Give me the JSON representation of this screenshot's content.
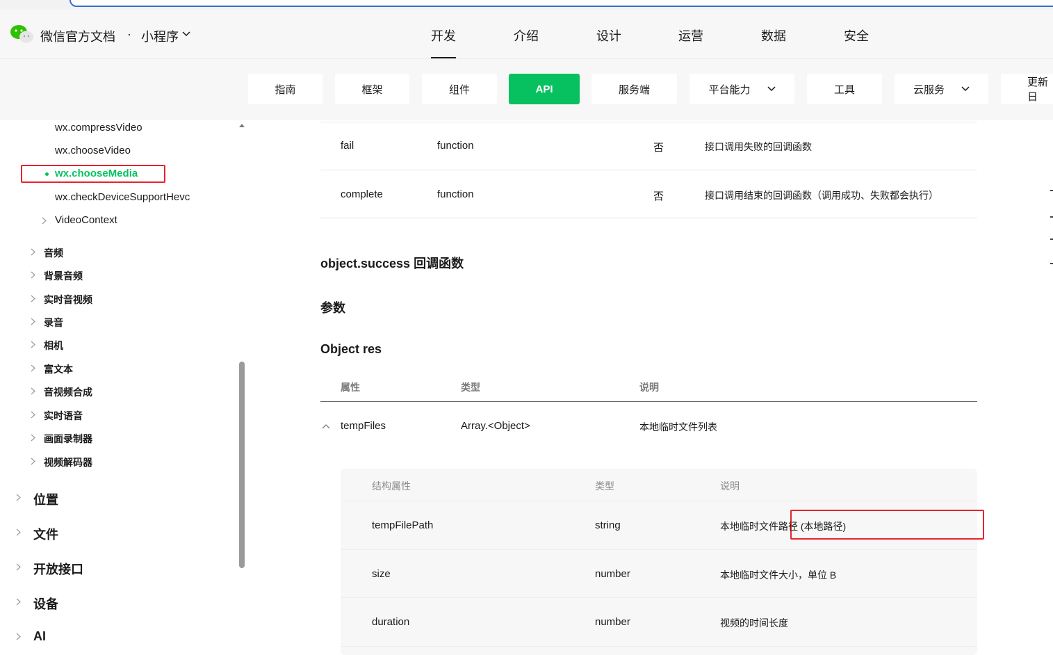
{
  "header": {
    "brand": "微信官方文档",
    "brand_sub": "小程序",
    "nav": [
      "开发",
      "介绍",
      "设计",
      "运营",
      "数据",
      "安全"
    ]
  },
  "tabs": [
    "指南",
    "框架",
    "组件",
    "API",
    "服务端",
    "平台能力",
    "工具",
    "云服务",
    "更新日"
  ],
  "sidebar": {
    "video_items": [
      "wx.compressVideo",
      "wx.chooseVideo",
      "wx.chooseMedia",
      "wx.checkDeviceSupportHevc",
      "VideoContext"
    ],
    "media_groups": [
      "音频",
      "背景音频",
      "实时音视频",
      "录音",
      "相机",
      "富文本",
      "音视频合成",
      "实时语音",
      "画面录制器",
      "视频解码器"
    ],
    "top_groups": [
      "位置",
      "文件",
      "开放接口",
      "设备",
      "AI"
    ]
  },
  "param_rows": [
    {
      "name": "fail",
      "type": "function",
      "required": "否",
      "desc": "接口调用失败的回调函数"
    },
    {
      "name": "complete",
      "type": "function",
      "required": "否",
      "desc": "接口调用结束的回调函数（调用成功、失败都会执行）"
    }
  ],
  "section": {
    "success_title": "object.success 回调函数",
    "params_title": "参数",
    "res_title": "Object res"
  },
  "res_table": {
    "headers": [
      "属性",
      "类型",
      "说明"
    ],
    "row": {
      "name": "tempFiles",
      "type": "Array.<Object>",
      "desc": "本地临时文件列表"
    }
  },
  "sub_table": {
    "headers": [
      "结构属性",
      "类型",
      "说明"
    ],
    "rows": [
      {
        "name": "tempFilePath",
        "type": "string",
        "desc": "本地临时文件路径 (本地路径)"
      },
      {
        "name": "size",
        "type": "number",
        "desc": "本地临时文件大小，单位 B"
      },
      {
        "name": "duration",
        "type": "number",
        "desc": "视频的时间长度"
      }
    ]
  }
}
